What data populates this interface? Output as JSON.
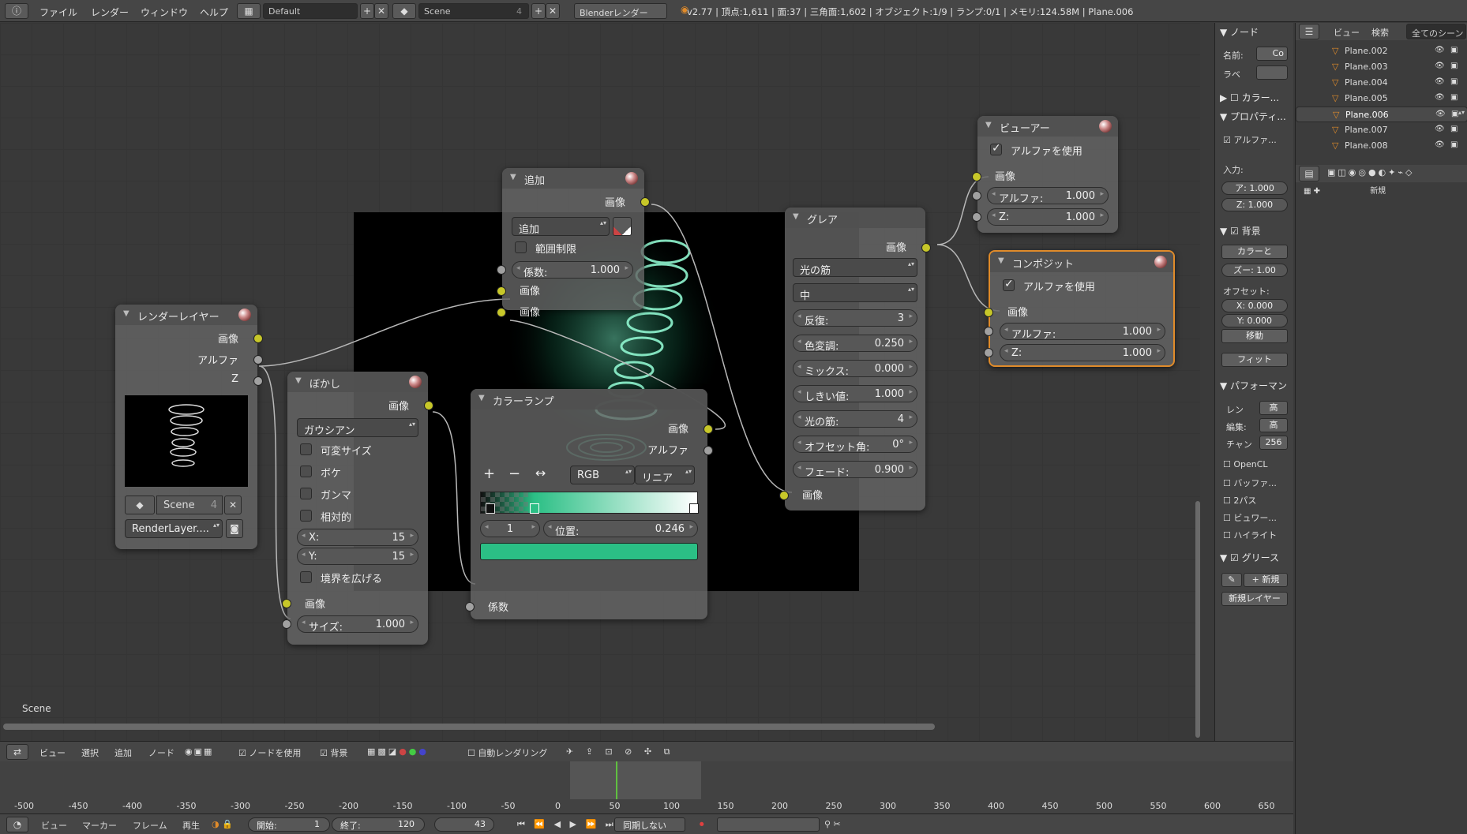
{
  "topbar": {
    "menus": [
      "ファイル",
      "レンダー",
      "ウィンドウ",
      "ヘルプ"
    ],
    "layout": "Default",
    "scene": "Scene",
    "scene_users": "4",
    "engine": "Blenderレンダー",
    "stats": "v2.77 | 頂点:1,611 | 面:37 | 三角面:1,602 | オブジェクト:1/9 | ランプ:0/1 | メモリ:124.58M | Plane.006"
  },
  "editor": {
    "scene_label": "Scene"
  },
  "nodes": {
    "render_layers": {
      "title": "レンダーレイヤー",
      "out_image": "画像",
      "out_alpha": "アルファ",
      "out_z": "Z",
      "scene": "Scene",
      "users": "4",
      "layer": "RenderLayer...."
    },
    "blur": {
      "title": "ぼかし",
      "out_image": "画像",
      "filter": "ガウシアン",
      "variable_size": "可変サイズ",
      "bokeh": "ボケ",
      "gamma": "ガンマ",
      "relative": "相対的",
      "x_label": "X:",
      "x_value": "15",
      "y_label": "Y:",
      "y_value": "15",
      "extend_bounds": "境界を広げる",
      "in_image": "画像",
      "size_label": "サイズ:",
      "size_value": "1.000"
    },
    "add": {
      "title": "追加",
      "out_image": "画像",
      "blend": "追加",
      "clamp": "範囲制限",
      "fac_label": "係数:",
      "fac_value": "1.000",
      "in_image1": "画像",
      "in_image2": "画像"
    },
    "color_ramp": {
      "title": "カラーランプ",
      "out_image": "画像",
      "out_alpha": "アルファ",
      "color_mode": "RGB",
      "interpolation": "リニア",
      "stop_index": "1",
      "pos_label": "位置:",
      "pos_value": "0.246",
      "color": "#2bbf85",
      "in_fac": "係数"
    },
    "glare": {
      "title": "グレア",
      "out_image": "画像",
      "type": "光の筋",
      "quality": "中",
      "iter_label": "反復:",
      "iter_value": "3",
      "color_mod_label": "色変調:",
      "color_mod_value": "0.250",
      "mix_label": "ミックス:",
      "mix_value": "0.000",
      "threshold_label": "しきい値:",
      "threshold_value": "1.000",
      "streaks_label": "光の筋:",
      "streaks_value": "4",
      "angle_label": "オフセット角:",
      "angle_value": "0°",
      "fade_label": "フェード:",
      "fade_value": "0.900",
      "in_image": "画像"
    },
    "viewer": {
      "title": "ビューアー",
      "use_alpha": "アルファを使用",
      "in_image": "画像",
      "alpha_label": "アルファ:",
      "alpha_value": "1.000",
      "z_label": "Z:",
      "z_value": "1.000"
    },
    "composite": {
      "title": "コンポジット",
      "use_alpha": "アルファを使用",
      "in_image": "画像",
      "alpha_label": "アルファ:",
      "alpha_value": "1.000",
      "z_label": "Z:",
      "z_value": "1.000"
    }
  },
  "props": {
    "node_section": "ノード",
    "name_label": "名前:",
    "name_value": "Co",
    "label_label": "ラベ",
    "color_section": "カラー...",
    "properties_section": "プロパティ...",
    "use_alpha": "アルファ...",
    "inputs_label": "入力:",
    "input_a": "ア: 1.000",
    "input_z": "Z: 1.000",
    "backdrop_section": "背景",
    "channels": "カラーと",
    "zoom": "ズー: 1.00",
    "offset_label": "オフセット:",
    "offset_x": "X: 0.000",
    "offset_y": "Y: 0.000",
    "move": "移動",
    "fit": "フィット",
    "perf_section": "パフォーマン",
    "render_label": "レン",
    "render_value": "高",
    "edit_label": "編集:",
    "edit_value": "高",
    "chunk_label": "チャン",
    "chunk_value": "256",
    "opencl": "OpenCL",
    "buffer": "バッファ...",
    "two_pass": "2パス",
    "viewer_border": "ビュワー...",
    "highlight": "ハイライト",
    "grease_section": "グリース",
    "new_btn": "新規",
    "new_layer": "新規レイヤー"
  },
  "outliner": {
    "view": "ビュー",
    "search": "検索",
    "filter": "全てのシーン",
    "items": [
      "Plane.002",
      "Plane.003",
      "Plane.004",
      "Plane.005",
      "Plane.006",
      "Plane.007",
      "Plane.008"
    ],
    "new_label": "新規"
  },
  "nodebar": {
    "view": "ビュー",
    "select": "選択",
    "add": "追加",
    "node": "ノード",
    "use_nodes": "ノードを使用",
    "backdrop": "背景",
    "auto_render": "自動レンダリング"
  },
  "timeline": {
    "ticks": [
      "-500",
      "-450",
      "-400",
      "-350",
      "-300",
      "-250",
      "-200",
      "-150",
      "-100",
      "-50",
      "0",
      "50",
      "100",
      "150",
      "200",
      "250",
      "300",
      "350",
      "400",
      "450",
      "500",
      "550",
      "600",
      "650"
    ],
    "current_frame": 43
  },
  "tlbar": {
    "view": "ビュー",
    "marker": "マーカー",
    "frame": "フレーム",
    "play": "再生",
    "start": "開始:",
    "start_value": "1",
    "end": "終了:",
    "end_value": "120",
    "current": "43",
    "sync": "同期しない"
  }
}
